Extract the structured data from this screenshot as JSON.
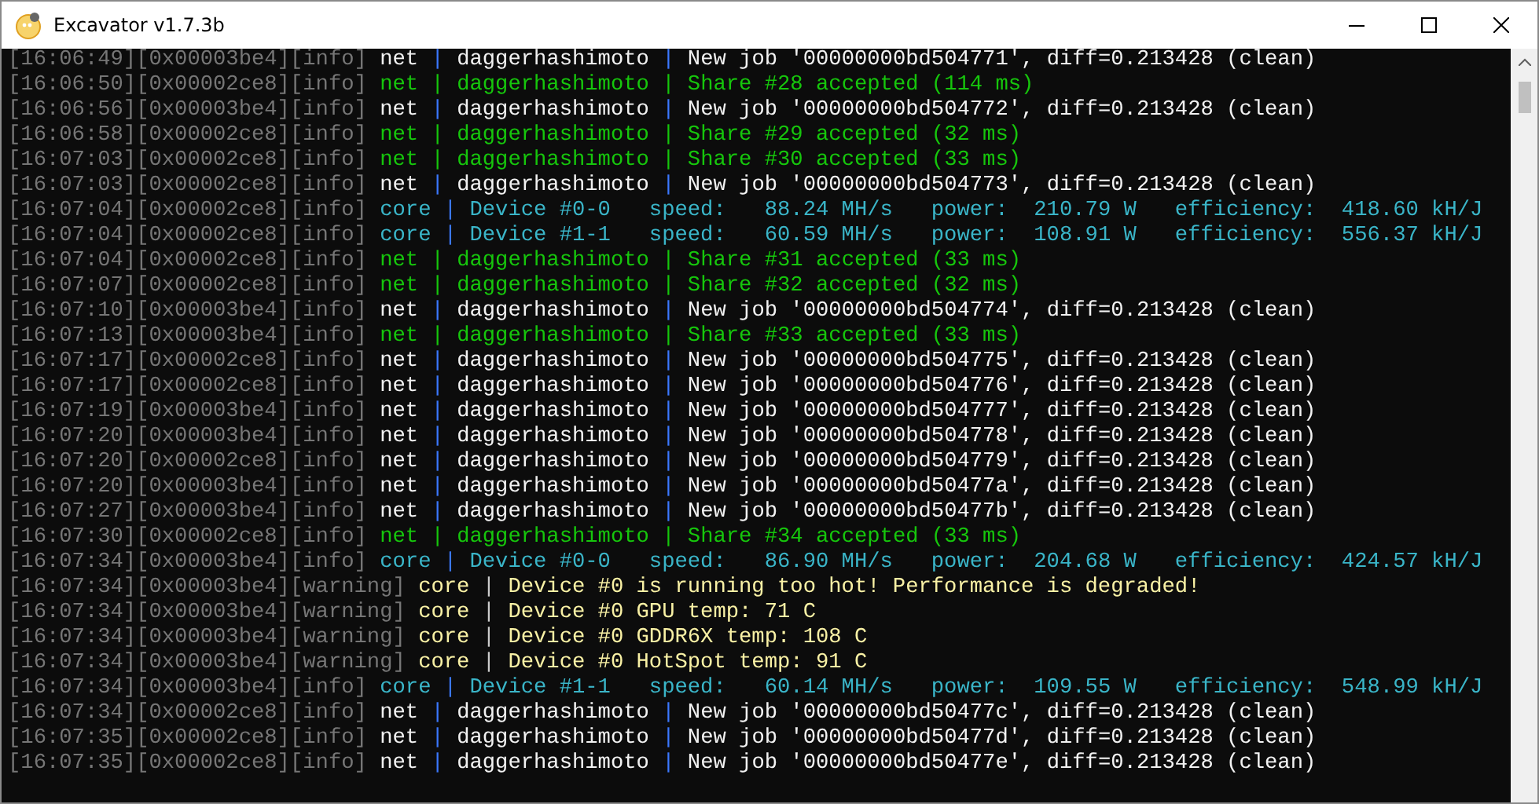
{
  "window": {
    "title": "Excavator v1.7.3b"
  },
  "lines": [
    {
      "prefix": "[16:06:49][0x00003be4][info]",
      "kind": "plain",
      "message": "net | daggerhashimoto | New job '00000000bd504771', diff=0.213428 (clean)"
    },
    {
      "prefix": "[16:06:50][0x00002ce8][info]",
      "kind": "share",
      "message": "net | daggerhashimoto | Share #28 accepted (114 ms)"
    },
    {
      "prefix": "[16:06:56][0x00003be4][info]",
      "kind": "plain",
      "message": "net | daggerhashimoto | New job '00000000bd504772', diff=0.213428 (clean)"
    },
    {
      "prefix": "[16:06:58][0x00002ce8][info]",
      "kind": "share",
      "message": "net | daggerhashimoto | Share #29 accepted (32 ms)"
    },
    {
      "prefix": "[16:07:03][0x00002ce8][info]",
      "kind": "share",
      "message": "net | daggerhashimoto | Share #30 accepted (33 ms)"
    },
    {
      "prefix": "[16:07:03][0x00002ce8][info]",
      "kind": "plain",
      "message": "net | daggerhashimoto | New job '00000000bd504773', diff=0.213428 (clean)"
    },
    {
      "prefix": "[16:07:04][0x00002ce8][info]",
      "kind": "core",
      "message": "core | Device #0-0   speed:   88.24 MH/s   power:  210.79 W   efficiency:  418.60 kH/J"
    },
    {
      "prefix": "[16:07:04][0x00002ce8][info]",
      "kind": "core",
      "message": "core | Device #1-1   speed:   60.59 MH/s   power:  108.91 W   efficiency:  556.37 kH/J"
    },
    {
      "prefix": "[16:07:04][0x00002ce8][info]",
      "kind": "share",
      "message": "net | daggerhashimoto | Share #31 accepted (33 ms)"
    },
    {
      "prefix": "[16:07:07][0x00002ce8][info]",
      "kind": "share",
      "message": "net | daggerhashimoto | Share #32 accepted (32 ms)"
    },
    {
      "prefix": "[16:07:10][0x00003be4][info]",
      "kind": "plain",
      "message": "net | daggerhashimoto | New job '00000000bd504774', diff=0.213428 (clean)"
    },
    {
      "prefix": "[16:07:13][0x00003be4][info]",
      "kind": "share",
      "message": "net | daggerhashimoto | Share #33 accepted (33 ms)"
    },
    {
      "prefix": "[16:07:17][0x00002ce8][info]",
      "kind": "plain",
      "message": "net | daggerhashimoto | New job '00000000bd504775', diff=0.213428 (clean)"
    },
    {
      "prefix": "[16:07:17][0x00002ce8][info]",
      "kind": "plain",
      "message": "net | daggerhashimoto | New job '00000000bd504776', diff=0.213428 (clean)"
    },
    {
      "prefix": "[16:07:19][0x00003be4][info]",
      "kind": "plain",
      "message": "net | daggerhashimoto | New job '00000000bd504777', diff=0.213428 (clean)"
    },
    {
      "prefix": "[16:07:20][0x00003be4][info]",
      "kind": "plain",
      "message": "net | daggerhashimoto | New job '00000000bd504778', diff=0.213428 (clean)"
    },
    {
      "prefix": "[16:07:20][0x00002ce8][info]",
      "kind": "plain",
      "message": "net | daggerhashimoto | New job '00000000bd504779', diff=0.213428 (clean)"
    },
    {
      "prefix": "[16:07:20][0x00003be4][info]",
      "kind": "plain",
      "message": "net | daggerhashimoto | New job '00000000bd50477a', diff=0.213428 (clean)"
    },
    {
      "prefix": "[16:07:27][0x00003be4][info]",
      "kind": "plain",
      "message": "net | daggerhashimoto | New job '00000000bd50477b', diff=0.213428 (clean)"
    },
    {
      "prefix": "[16:07:30][0x00002ce8][info]",
      "kind": "share",
      "message": "net | daggerhashimoto | Share #34 accepted (33 ms)"
    },
    {
      "prefix": "[16:07:34][0x00003be4][info]",
      "kind": "core",
      "message": "core | Device #0-0   speed:   86.90 MH/s   power:  204.68 W   efficiency:  424.57 kH/J"
    },
    {
      "prefix": "[16:07:34][0x00003be4][warning]",
      "kind": "warning",
      "message": "core | Device #0 is running too hot! Performance is degraded!"
    },
    {
      "prefix": "[16:07:34][0x00003be4][warning]",
      "kind": "warning",
      "message": "core | Device #0 GPU temp: 71 C"
    },
    {
      "prefix": "[16:07:34][0x00003be4][warning]",
      "kind": "warning",
      "message": "core | Device #0 GDDR6X temp: 108 C"
    },
    {
      "prefix": "[16:07:34][0x00003be4][warning]",
      "kind": "warning",
      "message": "core | Device #0 HotSpot temp: 91 C"
    },
    {
      "prefix": "[16:07:34][0x00003be4][info]",
      "kind": "core",
      "message": "core | Device #1-1   speed:   60.14 MH/s   power:  109.55 W   efficiency:  548.99 kH/J"
    },
    {
      "prefix": "[16:07:34][0x00002ce8][info]",
      "kind": "plain",
      "message": "net | daggerhashimoto | New job '00000000bd50477c', diff=0.213428 (clean)"
    },
    {
      "prefix": "[16:07:35][0x00002ce8][info]",
      "kind": "plain",
      "message": "net | daggerhashimoto | New job '00000000bd50477d', diff=0.213428 (clean)"
    },
    {
      "prefix": "[16:07:35][0x00002ce8][info]",
      "kind": "plain",
      "message": "net | daggerhashimoto | New job '00000000bd50477e', diff=0.213428 (clean)"
    }
  ]
}
